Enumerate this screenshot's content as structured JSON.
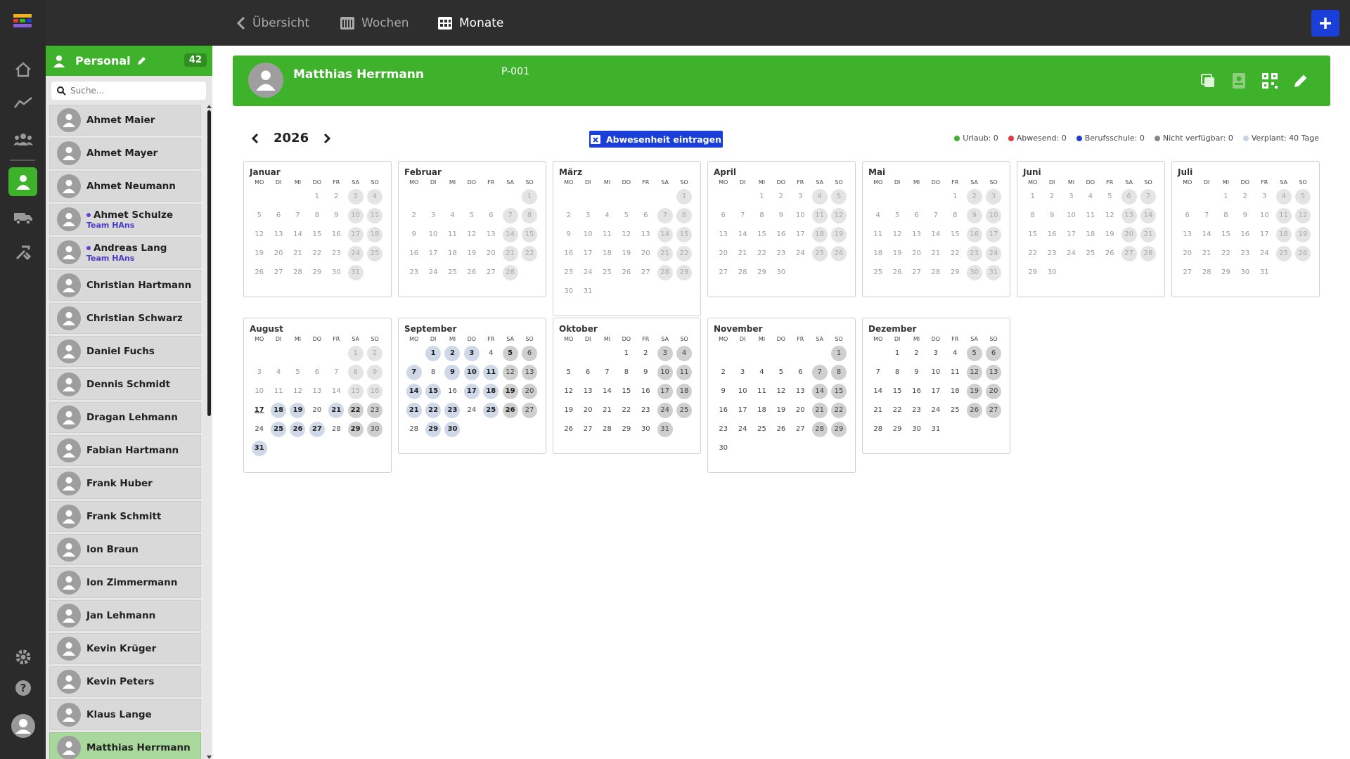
{
  "topnav": {
    "items": [
      {
        "label": "Übersicht",
        "icon": "chevron-left-icon"
      },
      {
        "label": "Wochen",
        "icon": "week-icon"
      },
      {
        "label": "Monate",
        "icon": "month-icon"
      }
    ]
  },
  "sidebar": {
    "title": "Personal",
    "count": "42",
    "search_placeholder": "Suche...",
    "people": [
      {
        "name": "Ahmet Maier"
      },
      {
        "name": "Ahmet Mayer"
      },
      {
        "name": "Ahmet Neumann"
      },
      {
        "name": "Ahmet Schulze",
        "team": "Team HAns"
      },
      {
        "name": "Andreas Lang",
        "team": "Team HAns"
      },
      {
        "name": "Christian Hartmann"
      },
      {
        "name": "Christian Schwarz"
      },
      {
        "name": "Daniel Fuchs"
      },
      {
        "name": "Dennis Schmidt"
      },
      {
        "name": "Dragan Lehmann"
      },
      {
        "name": "Fabian Hartmann"
      },
      {
        "name": "Frank Huber"
      },
      {
        "name": "Frank Schmitt"
      },
      {
        "name": "Ion Braun"
      },
      {
        "name": "Ion Zimmermann"
      },
      {
        "name": "Jan Lehmann"
      },
      {
        "name": "Kevin Krüger"
      },
      {
        "name": "Kevin Peters"
      },
      {
        "name": "Klaus Lange"
      },
      {
        "name": "Matthias Herrmann",
        "selected": true
      }
    ]
  },
  "banner": {
    "name": "Matthias Herrmann",
    "id": "P-001"
  },
  "calendar": {
    "year": "2026",
    "absence_button": "Abwesenheit eintragen",
    "legend": [
      {
        "label": "Urlaub: 0",
        "color": "#3db22a"
      },
      {
        "label": "Abwesend: 0",
        "color": "#e0393e"
      },
      {
        "label": "Berufsschule: 0",
        "color": "#1a3fd9"
      },
      {
        "label": "Nicht verfügbar: 0",
        "color": "#888888"
      },
      {
        "label": "Verplant: 40 Tage",
        "color": "#c9d3e3"
      }
    ],
    "weekdays": [
      "MO",
      "DI",
      "MI",
      "DO",
      "FR",
      "SA",
      "SO"
    ],
    "today": {
      "month": 8,
      "day": 17
    },
    "months": [
      {
        "name": "Januar",
        "offset": 3,
        "days": 31
      },
      {
        "name": "Februar",
        "offset": 6,
        "days": 28
      },
      {
        "name": "März",
        "offset": 6,
        "days": 31
      },
      {
        "name": "April",
        "offset": 2,
        "days": 30
      },
      {
        "name": "Mai",
        "offset": 4,
        "days": 31
      },
      {
        "name": "Juni",
        "offset": 0,
        "days": 30
      },
      {
        "name": "Juli",
        "offset": 2,
        "days": 31
      },
      {
        "name": "August",
        "offset": 5,
        "days": 31,
        "planned": [
          18,
          19,
          21,
          22,
          25,
          26,
          27,
          29,
          31
        ]
      },
      {
        "name": "September",
        "offset": 1,
        "days": 30,
        "planned": [
          1,
          2,
          3,
          5,
          7,
          9,
          10,
          11,
          14,
          15,
          17,
          18,
          19,
          21,
          22,
          23,
          25,
          26,
          29,
          30
        ]
      },
      {
        "name": "Oktober",
        "offset": 3,
        "days": 31
      },
      {
        "name": "November",
        "offset": 6,
        "days": 30
      },
      {
        "name": "Dezember",
        "offset": 1,
        "days": 31
      }
    ]
  }
}
